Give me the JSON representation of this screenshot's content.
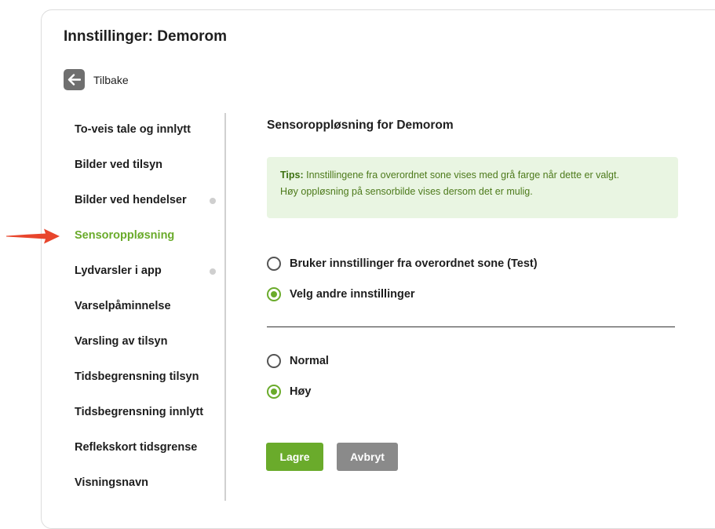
{
  "header": {
    "title": "Innstillinger: Demorom",
    "back_label": "Tilbake"
  },
  "sidebar": {
    "items": [
      {
        "label": "To-veis tale og innlytt",
        "active": false,
        "dot": false
      },
      {
        "label": "Bilder ved tilsyn",
        "active": false,
        "dot": false
      },
      {
        "label": "Bilder ved hendelser",
        "active": false,
        "dot": true
      },
      {
        "label": "Sensoroppløsning",
        "active": true,
        "dot": false
      },
      {
        "label": "Lydvarsler i app",
        "active": false,
        "dot": true
      },
      {
        "label": "Varselpåminnelse",
        "active": false,
        "dot": false
      },
      {
        "label": "Varsling av tilsyn",
        "active": false,
        "dot": false
      },
      {
        "label": "Tidsbegrensning tilsyn",
        "active": false,
        "dot": false
      },
      {
        "label": "Tidsbegrensning innlytt",
        "active": false,
        "dot": false
      },
      {
        "label": "Reflekskort tidsgrense",
        "active": false,
        "dot": false
      },
      {
        "label": "Visningsnavn",
        "active": false,
        "dot": false
      }
    ]
  },
  "main": {
    "section_title": "Sensoroppløsning for Demorom",
    "tip": {
      "prefix": "Tips:",
      "line1": "Innstillingene fra overordnet sone vises med grå farge når dette er valgt.",
      "line2": "Høy oppløsning på sensorbilde vises dersom det er mulig."
    },
    "source_options": [
      {
        "label": "Bruker innstillinger fra overordnet sone (Test)",
        "checked": false
      },
      {
        "label": "Velg andre innstillinger",
        "checked": true
      }
    ],
    "resolution_options": [
      {
        "label": "Normal",
        "checked": false
      },
      {
        "label": "Høy",
        "checked": true
      }
    ],
    "save_label": "Lagre",
    "cancel_label": "Avbryt"
  },
  "colors": {
    "accent": "#6aab2b",
    "tip_background": "#e9f5e2",
    "cancel_button": "#8a8a8a",
    "pointer_arrow": "#e8452c"
  },
  "icons": {
    "back": "arrow-left-icon",
    "pointer": "red-arrow-icon"
  }
}
